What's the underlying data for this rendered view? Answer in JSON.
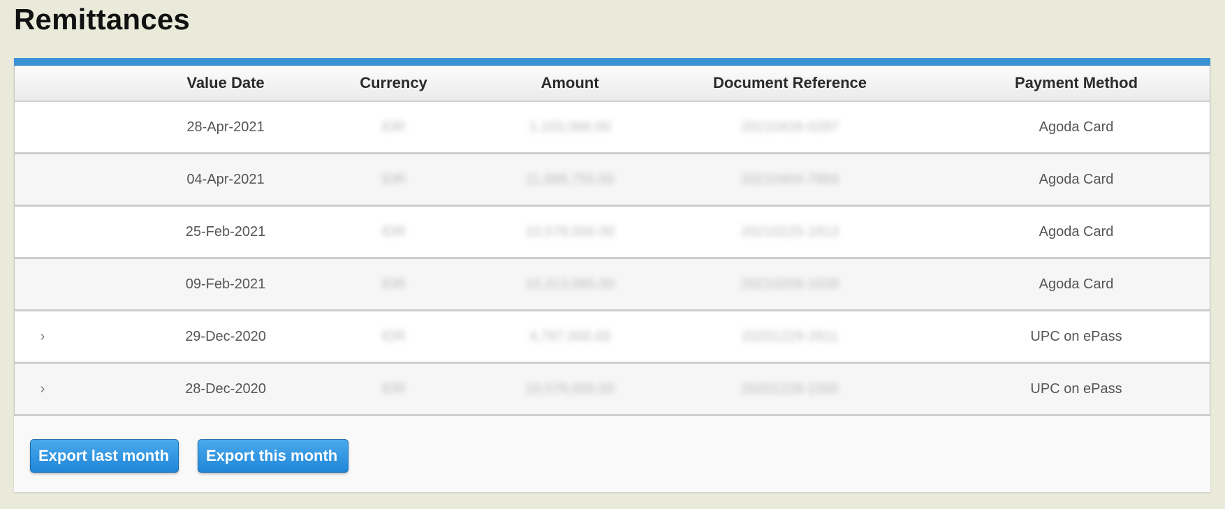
{
  "page": {
    "title": "Remittances"
  },
  "table": {
    "columns": {
      "value_date": "Value Date",
      "currency": "Currency",
      "amount": "Amount",
      "document_reference": "Document Reference",
      "payment_method": "Payment Method"
    },
    "rows": [
      {
        "value_date": "28-Apr-2021",
        "currency": "IDR",
        "amount": "1,103,066.00",
        "document_reference": "20210426-0287",
        "payment_method": "Agoda Card",
        "expandable": false
      },
      {
        "value_date": "04-Apr-2021",
        "currency": "IDR",
        "amount": "11,688,755.00",
        "document_reference": "20210404-7884",
        "payment_method": "Agoda Card",
        "expandable": false
      },
      {
        "value_date": "25-Feb-2021",
        "currency": "IDR",
        "amount": "10,578,000.00",
        "document_reference": "20210225-1813",
        "payment_method": "Agoda Card",
        "expandable": false
      },
      {
        "value_date": "09-Feb-2021",
        "currency": "IDR",
        "amount": "10,313,065.00",
        "document_reference": "20210209-1028",
        "payment_method": "Agoda Card",
        "expandable": false
      },
      {
        "value_date": "29-Dec-2020",
        "currency": "IDR",
        "amount": "4,787,000.00",
        "document_reference": "20201229-2811",
        "payment_method": "UPC on ePass",
        "expandable": true
      },
      {
        "value_date": "28-Dec-2020",
        "currency": "IDR",
        "amount": "10,578,000.00",
        "document_reference": "20201228-1565",
        "payment_method": "UPC on ePass",
        "expandable": true
      }
    ]
  },
  "actions": {
    "export_last_month": "Export last month",
    "export_this_month": "Export this month"
  },
  "colors": {
    "accent": "#3a93d6",
    "button": "#2a93e0",
    "background": "#eaeadb"
  },
  "icons": {
    "expand": "chevron-right-icon"
  }
}
